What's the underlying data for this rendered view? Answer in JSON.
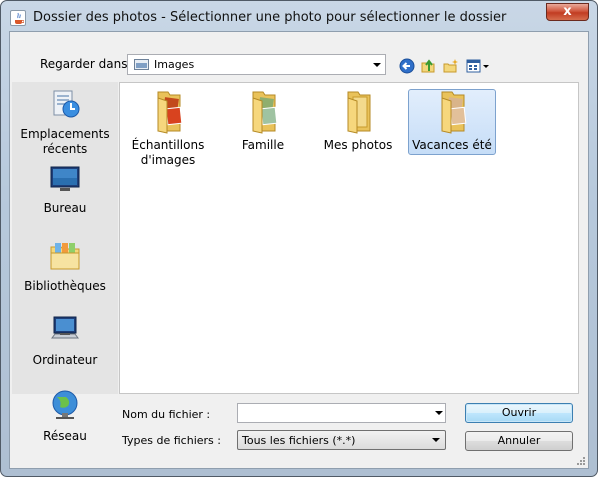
{
  "window": {
    "title": "Dossier des photos - Sélectionner une photo pour sélectionner le dossier",
    "close_symbol": "x"
  },
  "toolbar": {
    "look_in_label": "Regarder dans :",
    "look_in_value": "Images",
    "icons": [
      "back-icon",
      "up-folder-icon",
      "new-folder-icon",
      "view-menu-icon"
    ]
  },
  "places": [
    {
      "label": "Emplacements récents",
      "icon": "recent-places-icon"
    },
    {
      "label": "Bureau",
      "icon": "desktop-icon"
    },
    {
      "label": "Bibliothèques",
      "icon": "libraries-icon"
    },
    {
      "label": "Ordinateur",
      "icon": "computer-icon"
    },
    {
      "label": "Réseau",
      "icon": "network-icon"
    }
  ],
  "files": [
    {
      "label": "Échantillons d'images",
      "selected": false
    },
    {
      "label": "Famille",
      "selected": false
    },
    {
      "label": "Mes photos",
      "selected": false
    },
    {
      "label": "Vacances été",
      "selected": true
    }
  ],
  "form": {
    "file_name_label": "Nom du fichier :",
    "file_name_value": "",
    "file_types_label": "Types de fichiers :",
    "file_types_value": "Tous les fichiers (*.*)"
  },
  "buttons": {
    "open": "Ouvrir",
    "cancel": "Annuler"
  },
  "colors": {
    "selection": "#c6ddf7",
    "selection_border": "#7da2ce",
    "close_button": "#c13c22",
    "folder": "#f3d77c"
  }
}
